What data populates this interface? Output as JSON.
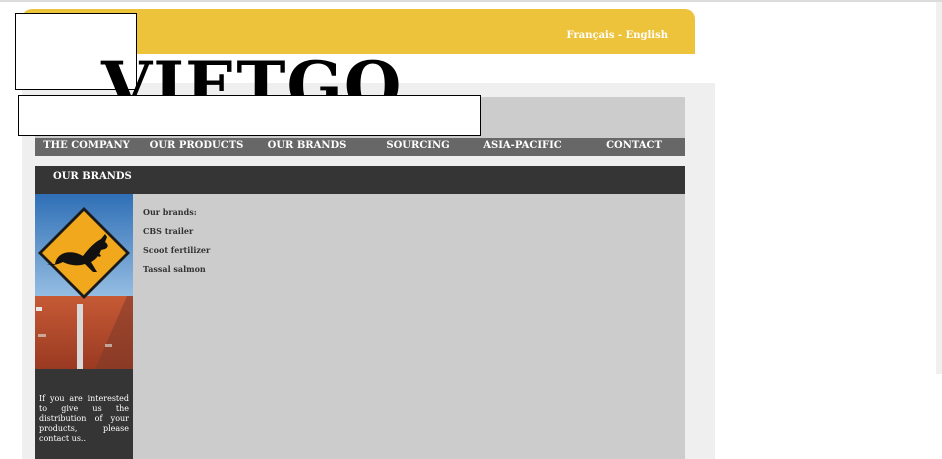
{
  "header": {
    "lang_fr": "Français",
    "lang_sep": " - ",
    "lang_en": "English"
  },
  "logo": {
    "text": "VIETGO"
  },
  "nav": [
    {
      "label": "THE COMPANY"
    },
    {
      "label": "OUR PRODUCTS"
    },
    {
      "label": "OUR BRANDS"
    },
    {
      "label": "SOURCING"
    },
    {
      "label": "ASIA-PACIFIC"
    },
    {
      "label": "CONTACT"
    }
  ],
  "section": {
    "title": "OUR BRANDS"
  },
  "sidebar": {
    "text": "If you are interested to give us the distribution of your products, please contact us.."
  },
  "content": {
    "heading": "Our brands:",
    "brands": [
      "CBS trailer",
      "Scoot fertilizer",
      "Tassal salmon"
    ]
  },
  "colors": {
    "header_yellow": "#eec33c",
    "nav_grey": "#676767",
    "dark_panel": "#353535",
    "content_grey": "#cccccc",
    "sign_yellow": "#f2a81d",
    "desert_red": "#b5472a"
  },
  "icons": [
    "kangaroo-crossing-sign-image"
  ]
}
